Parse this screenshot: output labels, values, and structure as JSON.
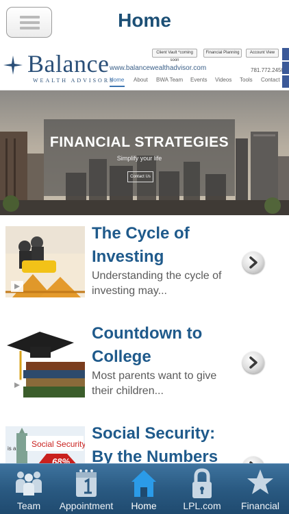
{
  "header": {
    "title": "Home",
    "menu_icon": "hamburger-icon"
  },
  "banner": {
    "logo_text": "Balance",
    "logo_subtitle": "WEALTH ADVISORS",
    "url": "www.balancewealthadvisor.com",
    "phone": "781.772.2450",
    "top_buttons": [
      "Client Vault *coming soon",
      "Financial Planning",
      "Account View"
    ],
    "nav": [
      "Home",
      "About",
      "BWA Team",
      "Events",
      "Videos",
      "Tools",
      "Contact"
    ],
    "hero_title": "FINANCIAL STRATEGIES",
    "hero_subtitle": "Simplify your life",
    "hero_button": "Contact Us"
  },
  "items": [
    {
      "title": "The Cycle of Investing",
      "description": "Understanding the cycle of investing may..."
    },
    {
      "title": "Countdown to College",
      "description": "Most parents want to give their children..."
    },
    {
      "title": "Social Security: By the Numbers",
      "description": "",
      "thumb_text": "Social Security",
      "thumb_badge": "68%",
      "thumb_prefix": "is a"
    }
  ],
  "tabbar": {
    "tabs": [
      {
        "label": "Team",
        "icon": "people-icon"
      },
      {
        "label": "Appointment",
        "icon": "calendar-icon"
      },
      {
        "label": "Home",
        "icon": "home-icon",
        "active": true
      },
      {
        "label": "LPL.com",
        "icon": "lock-icon"
      },
      {
        "label": "Financial",
        "icon": "star-icon"
      }
    ]
  },
  "colors": {
    "accent": "#1f5a8b",
    "tabbar": "#2a5a82",
    "text": "#5a5a5a"
  }
}
